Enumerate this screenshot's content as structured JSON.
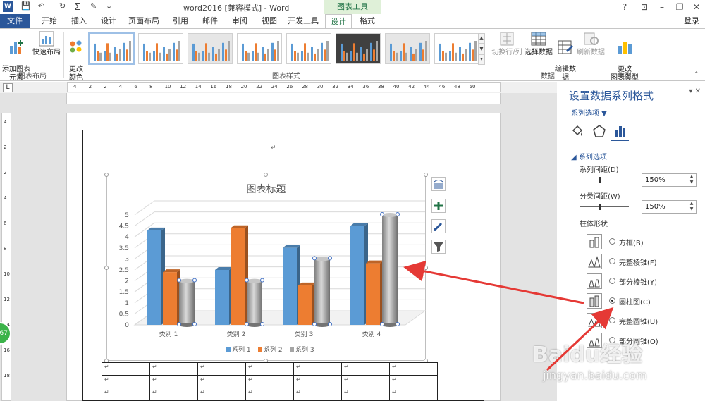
{
  "window": {
    "title": "word2016 [兼容模式] - Word",
    "contextual_group": "图表工具",
    "login": "登录",
    "controls": {
      "help": "?",
      "ribbon_options": "⊡",
      "minimize": "–",
      "restore": "❐",
      "close": "✕"
    }
  },
  "quick_access": {
    "word_icon": "W",
    "save": "💾",
    "undo": "↶",
    "redo": "↻",
    "sum": "∑",
    "draw": "✎",
    "more": "⌄"
  },
  "tabs": [
    {
      "label": "文件"
    },
    {
      "label": "开始"
    },
    {
      "label": "插入"
    },
    {
      "label": "设计"
    },
    {
      "label": "页面布局"
    },
    {
      "label": "引用"
    },
    {
      "label": "邮件"
    },
    {
      "label": "审阅"
    },
    {
      "label": "视图"
    },
    {
      "label": "开发工具"
    },
    {
      "label": "设计"
    },
    {
      "label": "格式"
    }
  ],
  "ribbon": {
    "add_element": "添加图表\n元素",
    "quick_layout": "快速布局",
    "group_layout": "图表布局",
    "change_color": "更改\n颜色",
    "group_styles": "图表样式",
    "switch_rowcol": "切换行/列",
    "select_data": "选择数据",
    "edit_data": "编辑数\n据",
    "refresh_data": "刷新数据",
    "group_data": "数据",
    "change_type": "更改\n图表类型",
    "group_type": "类型"
  },
  "ruler": {
    "marks": [
      "4",
      "2",
      "2",
      "4",
      "6",
      "8",
      "10",
      "12",
      "14",
      "16",
      "18",
      "20",
      "22",
      "24",
      "26",
      "28",
      "30",
      "32",
      "34",
      "36",
      "38",
      "40",
      "42",
      "44",
      "46",
      "48",
      "50"
    ],
    "corner": "L",
    "vmarks": [
      "4",
      "2",
      "2",
      "4",
      "6",
      "8",
      "10",
      "12",
      "14",
      "16",
      "18"
    ]
  },
  "doc": {
    "para_mark": "↵",
    "cell_mark": "↵",
    "badge": "67"
  },
  "chart_data": {
    "type": "bar",
    "title": "图表标题",
    "categories": [
      "类别 1",
      "类别 2",
      "类别 3",
      "类别 4"
    ],
    "series": [
      {
        "name": "系列 1",
        "values": [
          4.3,
          2.5,
          3.5,
          4.5
        ],
        "color": "#5b9bd5"
      },
      {
        "name": "系列 2",
        "values": [
          2.4,
          4.4,
          1.8,
          2.8
        ],
        "color": "#ed7d31"
      },
      {
        "name": "系列 3",
        "values": [
          2.0,
          2.0,
          3.0,
          5.0
        ],
        "color": "#a5a5a5"
      }
    ],
    "yticks": [
      "0",
      "0.5",
      "1",
      "1.5",
      "2",
      "2.5",
      "3",
      "3.5",
      "4",
      "4.5",
      "5"
    ],
    "ylim": [
      0,
      5
    ],
    "grid": true,
    "legend": "bottom"
  },
  "pane": {
    "title": "设置数据系列格式",
    "subtitle": "系列选项 ▼",
    "section": "◢ 系列选项",
    "gap_depth_label": "系列间距(D)",
    "gap_depth_value": "150%",
    "gap_width_label": "分类间距(W)",
    "gap_width_value": "150%",
    "shape_label": "柱体形状",
    "shapes": [
      {
        "label": "方框(B)",
        "checked": false
      },
      {
        "label": "完整棱锥(F)",
        "checked": false
      },
      {
        "label": "部分棱锥(Y)",
        "checked": false
      },
      {
        "label": "圆柱图(C)",
        "checked": true
      },
      {
        "label": "完整圆锥(U)",
        "checked": false
      },
      {
        "label": "部分圆锥(O)",
        "checked": false
      }
    ]
  },
  "watermark": {
    "brand": "Baidu经验",
    "url": "jingyan.baidu.com"
  }
}
